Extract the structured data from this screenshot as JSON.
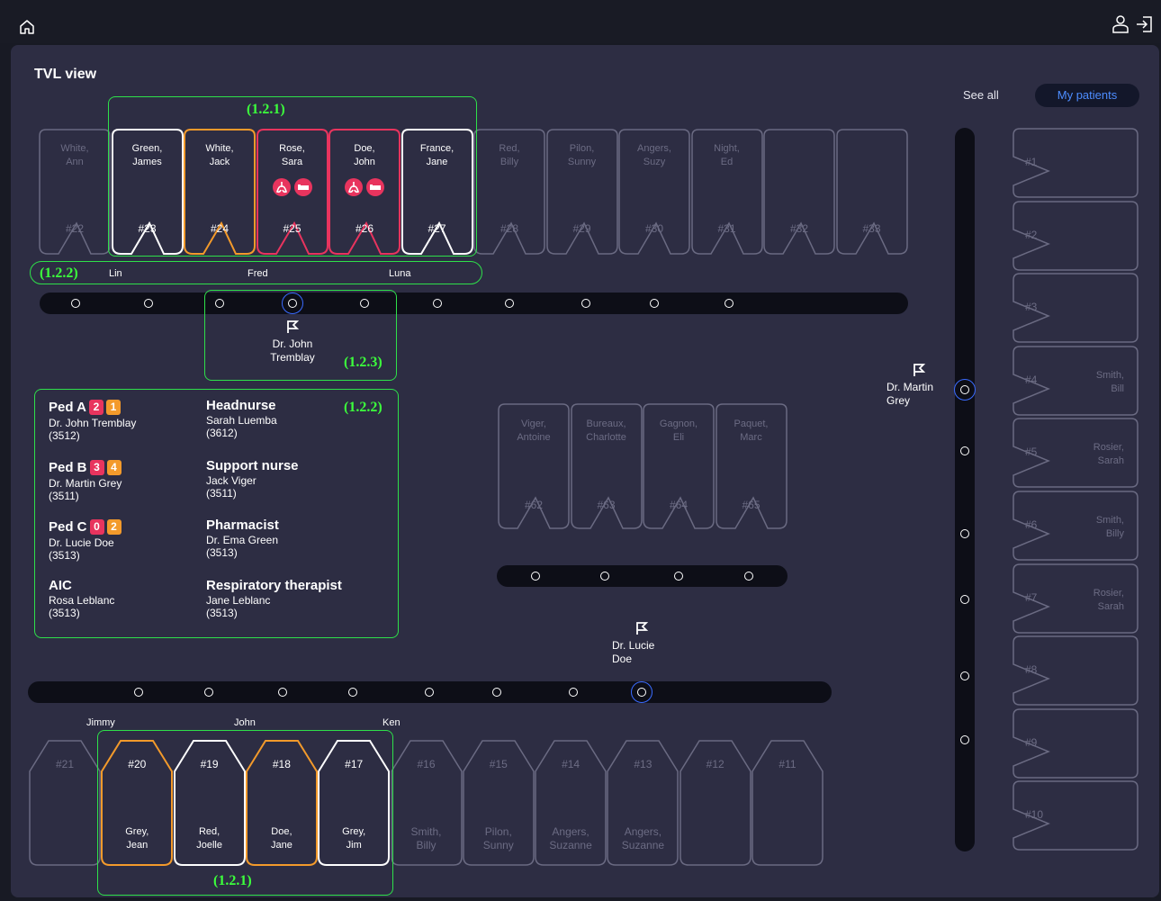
{
  "header": {
    "home_icon": "home-icon",
    "user_icon": "user-icon",
    "logout_icon": "logout-icon"
  },
  "view_title": "TVL view",
  "filters": {
    "see_all": "See all",
    "my_patients": "My patients"
  },
  "annotations": {
    "top_beds": "(1.2.1)",
    "top_nurses": "(1.2.2)",
    "doctor_popup": "(1.2.3)",
    "staff_panel": "(1.2.2)",
    "bottom_beds": "(1.2.1)"
  },
  "top_row": {
    "beds": [
      {
        "name": "White,\nAnn",
        "num": "#22",
        "state": "inactive"
      },
      {
        "name": "Green,\nJames",
        "num": "#23",
        "state": "white"
      },
      {
        "name": "White,\nJack",
        "num": "#24",
        "state": "orange"
      },
      {
        "name": "Rose,\nSara",
        "num": "#25",
        "state": "red",
        "icons": [
          "lungs-icon",
          "bed-icon"
        ]
      },
      {
        "name": "Doe,\nJohn",
        "num": "#26",
        "state": "red",
        "icons": [
          "lungs-icon",
          "bed-icon"
        ]
      },
      {
        "name": "France,\nJane",
        "num": "#27",
        "state": "white"
      },
      {
        "name": "Red,\nBilly",
        "num": "#28",
        "state": "inactive"
      },
      {
        "name": "Pilon,\nSunny",
        "num": "#29",
        "state": "inactive"
      },
      {
        "name": "Angers,\nSuzy",
        "num": "#30",
        "state": "inactive"
      },
      {
        "name": "Night,\nEd",
        "num": "#31",
        "state": "inactive"
      },
      {
        "name": "",
        "num": "#32",
        "state": "inactive"
      },
      {
        "name": "",
        "num": "#33",
        "state": "inactive"
      }
    ],
    "nurses": [
      "Lin",
      "Fred",
      "Luna"
    ]
  },
  "top_popup_doctor": "Dr. John\nTremblay",
  "right_doctor": "Dr. Martin\nGrey",
  "mid_doctor": "Dr. Lucie\nDoe",
  "staff": {
    "teams": [
      {
        "name": "Ped A",
        "badges": [
          "2",
          "1"
        ],
        "doctor": "Dr. John Tremblay",
        "ext": "(3512)"
      },
      {
        "name": "Ped B",
        "badges": [
          "3",
          "4"
        ],
        "doctor": "Dr. Martin Grey",
        "ext": "(3511)"
      },
      {
        "name": "Ped C",
        "badges": [
          "0",
          "2"
        ],
        "doctor": "Dr. Lucie Doe",
        "ext": "(3513)"
      },
      {
        "name": "AIC",
        "badges": [],
        "doctor": "Rosa Leblanc",
        "ext": "(3513)"
      }
    ],
    "roles": [
      {
        "name": "Headnurse",
        "person": "Sarah Luemba",
        "ext": "(3612)"
      },
      {
        "name": "Support nurse",
        "person": "Jack Viger",
        "ext": "(3511)"
      },
      {
        "name": "Pharmacist",
        "person": "Dr. Ema Green",
        "ext": "(3513)"
      },
      {
        "name": "Respiratory therapist",
        "person": "Jane Leblanc",
        "ext": "(3513)"
      }
    ],
    "badge_colors": {
      "first": "#e8345e",
      "second": "#f39a2b"
    }
  },
  "mid_row": {
    "beds": [
      {
        "name": "Viger,\nAntoine",
        "num": "#62"
      },
      {
        "name": "Bureaux,\nCharlotte",
        "num": "#63"
      },
      {
        "name": "Gagnon,\nEli",
        "num": "#64"
      },
      {
        "name": "Paquet,\nMarc",
        "num": "#65"
      }
    ]
  },
  "bottom_row": {
    "nurses": [
      "Jimmy",
      "John",
      "Ken"
    ],
    "beds": [
      {
        "name": "",
        "num": "#21",
        "state": "inactive"
      },
      {
        "name": "Grey,\nJean",
        "num": "#20",
        "state": "orange"
      },
      {
        "name": "Red,\nJoelle",
        "num": "#19",
        "state": "white"
      },
      {
        "name": "Doe,\nJane",
        "num": "#18",
        "state": "orange"
      },
      {
        "name": "Grey,\nJim",
        "num": "#17",
        "state": "white"
      },
      {
        "name": "Smith,\nBilly",
        "num": "#16",
        "state": "inactive"
      },
      {
        "name": "Pilon,\nSunny",
        "num": "#15",
        "state": "inactive"
      },
      {
        "name": "Angers,\nSuzanne",
        "num": "#14",
        "state": "inactive"
      },
      {
        "name": "Angers,\nSuzanne",
        "num": "#13",
        "state": "inactive"
      },
      {
        "name": "",
        "num": "#12",
        "state": "inactive"
      },
      {
        "name": "",
        "num": "#11",
        "state": "inactive"
      }
    ]
  },
  "right_column": {
    "beds": [
      {
        "num": "#1",
        "name": ""
      },
      {
        "num": "#2",
        "name": ""
      },
      {
        "num": "#3",
        "name": ""
      },
      {
        "num": "#4",
        "name": "Smith,\nBill"
      },
      {
        "num": "#5",
        "name": "Rosier,\nSarah"
      },
      {
        "num": "#6",
        "name": "Smith,\nBilly"
      },
      {
        "num": "#7",
        "name": "Rosier,\nSarah"
      },
      {
        "num": "#8",
        "name": ""
      },
      {
        "num": "#9",
        "name": ""
      },
      {
        "num": "#10",
        "name": ""
      }
    ]
  },
  "colors": {
    "red": "#e8345e",
    "orange": "#f39a2b",
    "white": "#ffffff",
    "inactive": "#6a6a82",
    "blue": "#3a6bff",
    "annotation": "#2ee04a"
  }
}
